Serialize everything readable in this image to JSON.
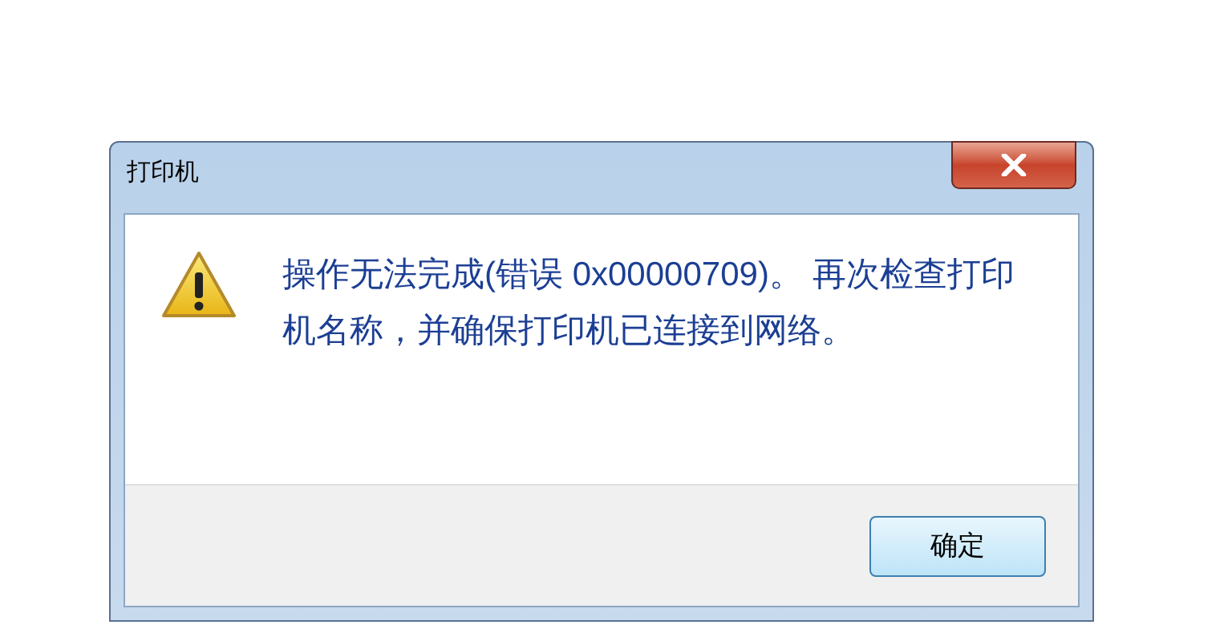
{
  "window": {
    "title": "打印机"
  },
  "message": {
    "kind": "warning",
    "text": "操作无法完成(错误 0x00000709)。 再次检查打印机名称，并确保打印机已连接到网络。"
  },
  "buttons": [
    {
      "label": "确定",
      "selected": true
    }
  ]
}
